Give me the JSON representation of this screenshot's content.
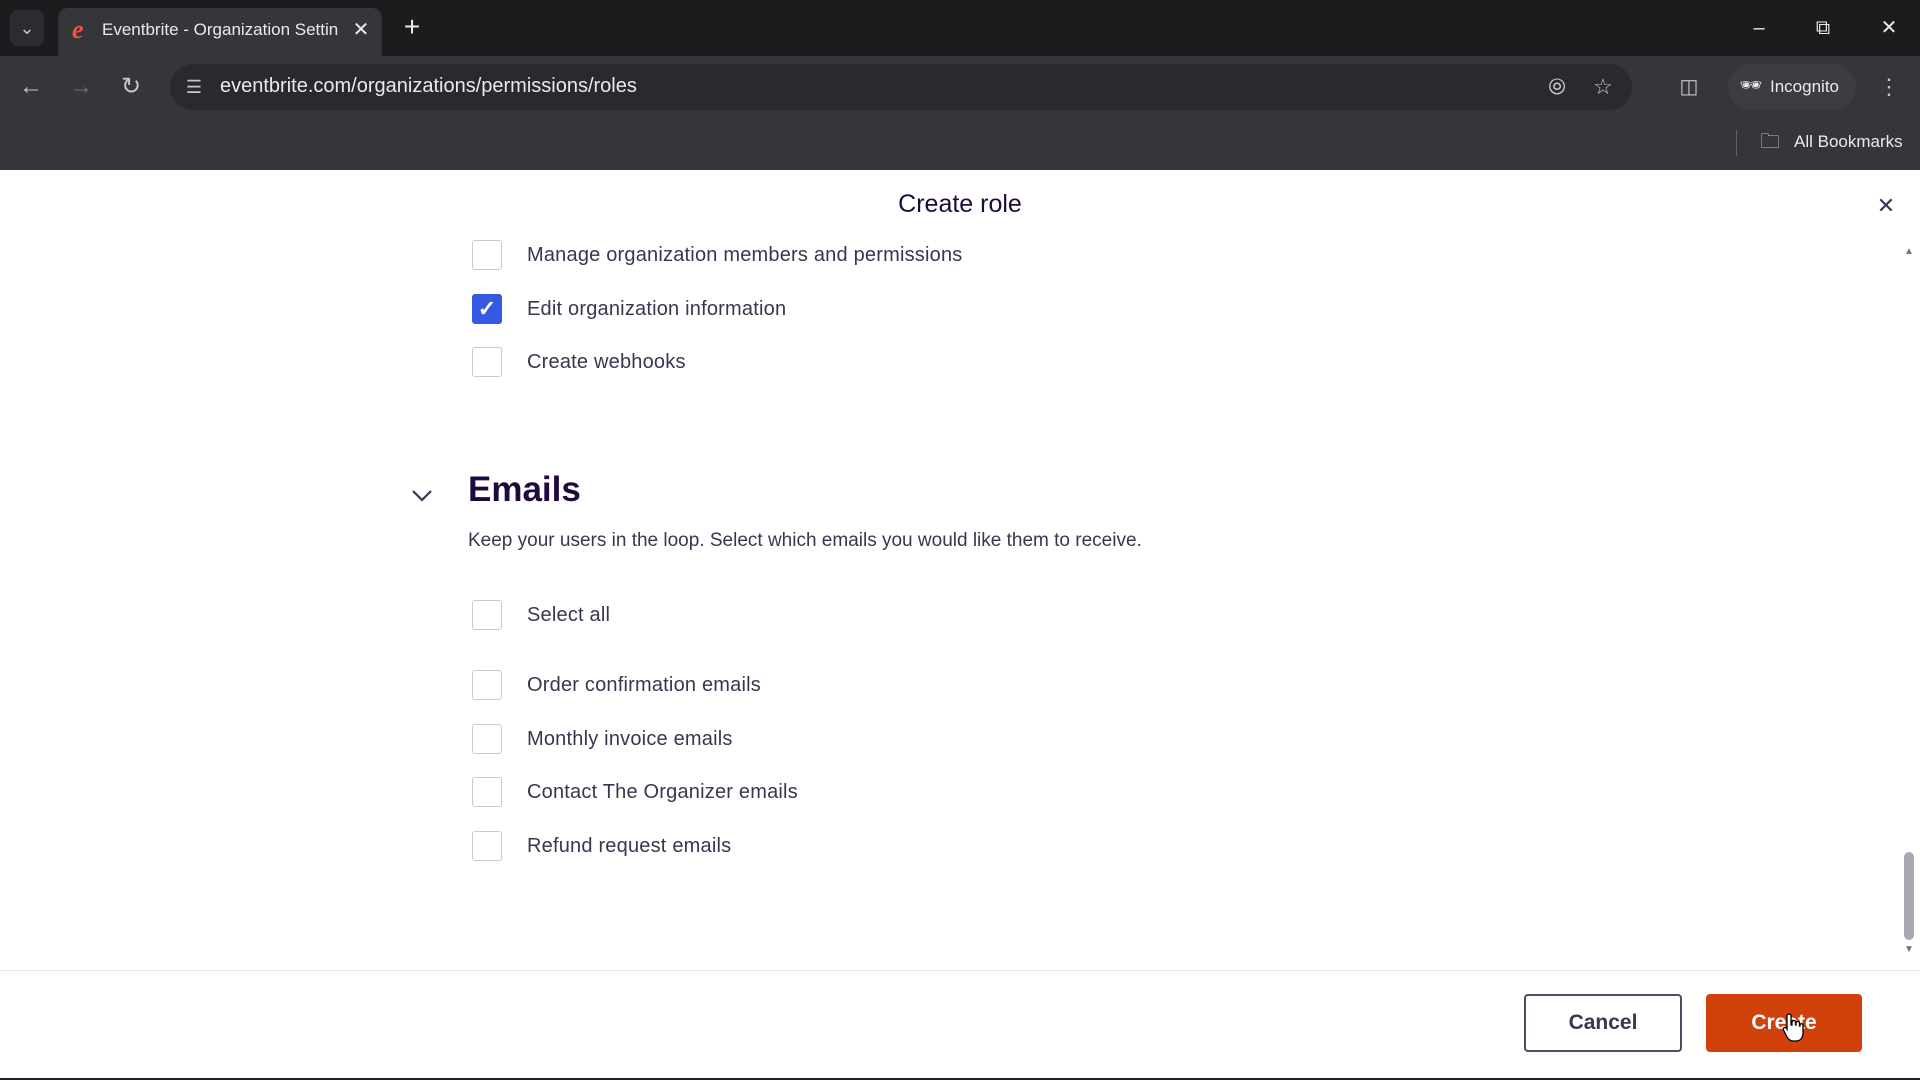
{
  "browser": {
    "tab_title": "Eventbrite - Organization Settin",
    "url": "eventbrite.com/organizations/permissions/roles",
    "incognito_label": "Incognito",
    "bookmarks_label": "All Bookmarks"
  },
  "modal": {
    "title": "Create role",
    "permissions": [
      {
        "label": "Manage organization members and permissions",
        "checked": false
      },
      {
        "label": "Edit organization information",
        "checked": true
      },
      {
        "label": "Create webhooks",
        "checked": false
      }
    ],
    "emails_section": {
      "title": "Emails",
      "description": "Keep your users in the loop. Select which emails you would like them to receive.",
      "select_all": "Select all",
      "items": [
        {
          "label": "Order confirmation emails",
          "checked": false
        },
        {
          "label": "Monthly invoice emails",
          "checked": false
        },
        {
          "label": "Contact The Organizer emails",
          "checked": false
        },
        {
          "label": "Refund request emails",
          "checked": false
        }
      ]
    },
    "cancel_label": "Cancel",
    "create_label": "Create"
  },
  "colors": {
    "primary_action": "#d1410c",
    "checkbox_checked": "#3659e3"
  }
}
